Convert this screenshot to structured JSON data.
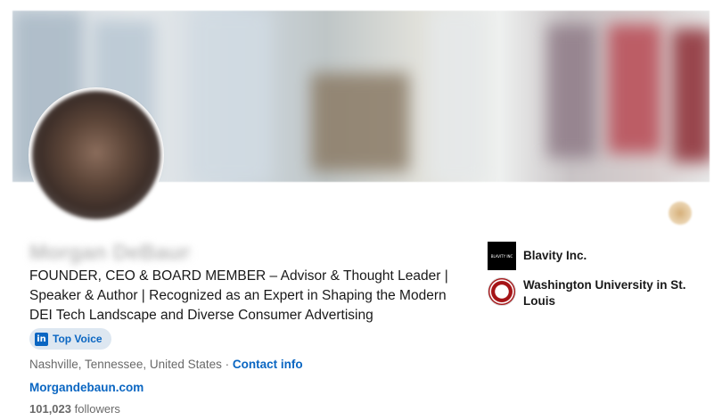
{
  "profile": {
    "name": "Morgan DeBaun",
    "headline": "FOUNDER, CEO & BOARD MEMBER – Advisor & Thought Leader | Speaker & Author | Recognized as an Expert in Shaping the Modern DEI Tech Landscape and Diverse Consumer Advertising",
    "badge": {
      "icon_text": "in",
      "label": "Top Voice"
    },
    "location": "Nashville, Tennessee, United States",
    "separator": " · ",
    "contact_link": "Contact info",
    "website": "Morgandebaun.com",
    "followers_count": "101,023",
    "followers_label": "followers"
  },
  "organizations": [
    {
      "name": "Blavity Inc.",
      "logo_text": "BLAVITY INC"
    },
    {
      "name": "Washington University in St. Louis"
    }
  ],
  "icons": {
    "badge": "linkedin-icon",
    "blavity": "blavity-logo",
    "washu": "washu-seal-logo",
    "corner": "decorative-emblem-icon"
  },
  "colors": {
    "link": "#0a66c2",
    "badge_bg": "#dde7f1"
  }
}
